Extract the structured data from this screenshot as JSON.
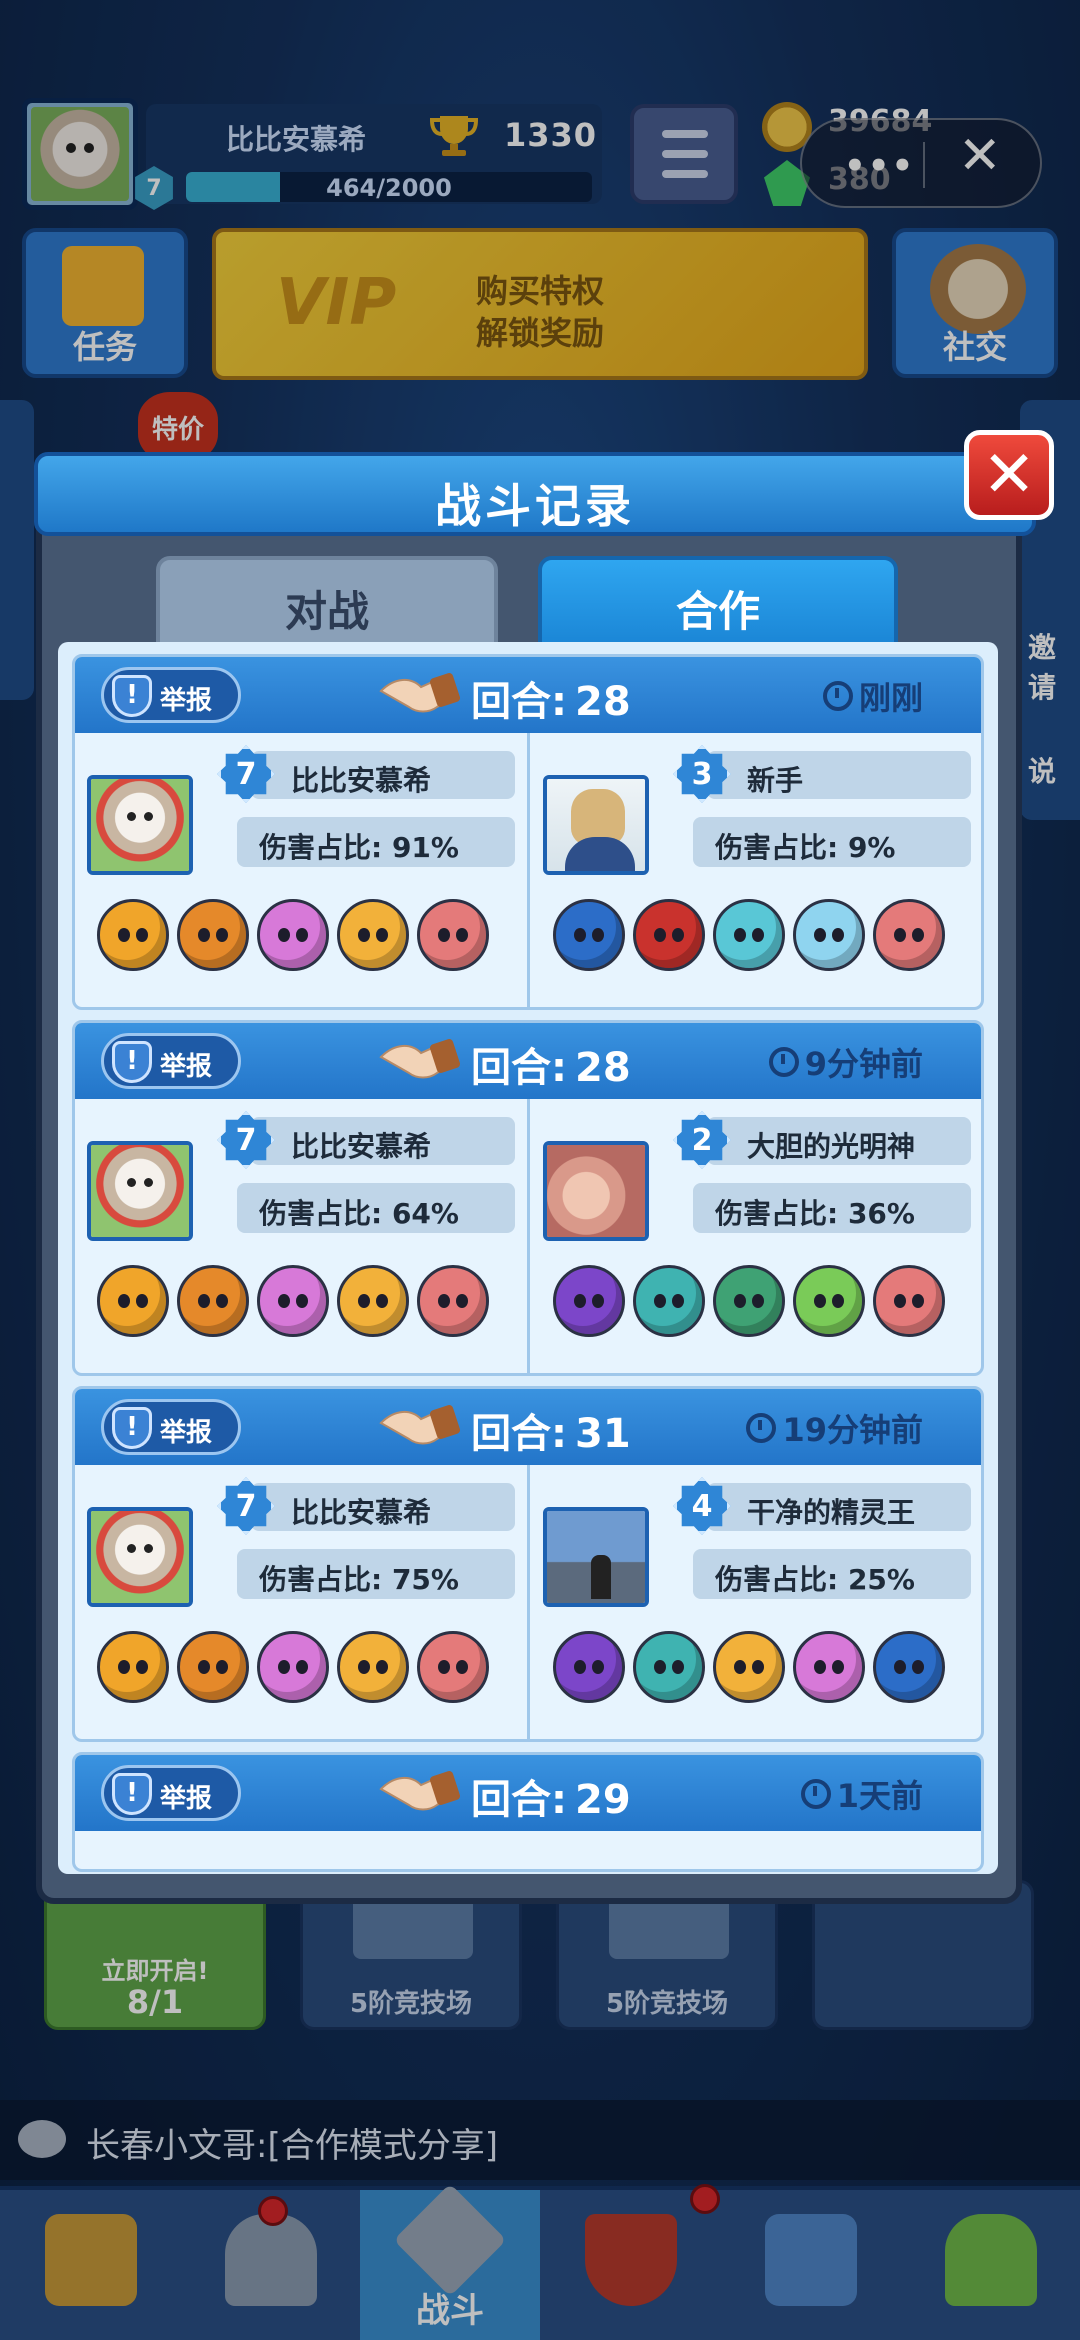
{
  "header": {
    "player_name": "比比安慕希",
    "trophies": "1330",
    "level": "7",
    "xp_text": "464/2000",
    "xp_fraction": 0.232,
    "coins": "39684",
    "gems": "380",
    "capsule_dots": "•••",
    "capsule_close": "✕"
  },
  "menu": {
    "task_label": "任务",
    "vip_logo": "VIP",
    "vip_line1": "购买特权",
    "vip_line2": "解锁奖励",
    "social_label": "社交",
    "sale_badge": "特价",
    "side_invite": "邀请",
    "side_say": "说"
  },
  "modal": {
    "title": "战斗记录",
    "close": "✕",
    "tabs": [
      {
        "label": "对战",
        "active": false
      },
      {
        "label": "合作",
        "active": true
      }
    ],
    "report_label": "举报",
    "round_prefix": "回合:",
    "damage_prefix": "伤害占比:",
    "records": [
      {
        "round": "28",
        "time": "刚刚",
        "left": {
          "level": "7",
          "name": "比比安慕希",
          "damage": "91%",
          "avatar": "cat-avatar",
          "heroes": [
            "#f0a52a",
            "#e5892a",
            "#d779d8",
            "#f2b13a",
            "#e47a7a"
          ]
        },
        "right": {
          "level": "3",
          "name": "新手",
          "damage": "9%",
          "avatar": "anime-avatar",
          "heroes": [
            "#2c6dc8",
            "#c9322d",
            "#59c7d6",
            "#8fd4ef",
            "#e47a7a"
          ]
        }
      },
      {
        "round": "28",
        "time": "9分钟前",
        "left": {
          "level": "7",
          "name": "比比安慕希",
          "damage": "64%",
          "avatar": "cat-avatar",
          "heroes": [
            "#f0a52a",
            "#e5892a",
            "#d779d8",
            "#f2b13a",
            "#e47a7a"
          ]
        },
        "right": {
          "level": "2",
          "name": "大胆的光明神",
          "damage": "36%",
          "avatar": "hands-avatar",
          "heroes": [
            "#7c46c9",
            "#3fb3b1",
            "#3fa274",
            "#7acb58",
            "#e47a7a"
          ]
        }
      },
      {
        "round": "31",
        "time": "19分钟前",
        "left": {
          "level": "7",
          "name": "比比安慕希",
          "damage": "75%",
          "avatar": "cat-avatar",
          "heroes": [
            "#f0a52a",
            "#e5892a",
            "#d779d8",
            "#f2b13a",
            "#e47a7a"
          ]
        },
        "right": {
          "level": "4",
          "name": "干净的精灵王",
          "damage": "25%",
          "avatar": "road-avatar",
          "heroes": [
            "#7c46c9",
            "#3fb3b1",
            "#f2b13a",
            "#d779d8",
            "#2c6dc8"
          ]
        }
      },
      {
        "round": "29",
        "time": "1天前"
      }
    ]
  },
  "chests": [
    {
      "line1": "立即开启!",
      "line2": "8/1",
      "state": "open"
    },
    {
      "label": "5阶竞技场"
    },
    {
      "label": "5阶竞技场"
    }
  ],
  "chat": {
    "text": "长春小文哥:[合作模式分享]"
  },
  "nav": {
    "items": [
      {
        "name": "shop",
        "icon": "treasure-chest-icon"
      },
      {
        "name": "cards",
        "icon": "knight-helmet-icon"
      },
      {
        "name": "battle",
        "icon": "crossed-swords-icon",
        "label": "战斗",
        "active": true
      },
      {
        "name": "clan",
        "icon": "crown-shield-icon"
      },
      {
        "name": "social",
        "icon": "friends-icon"
      },
      {
        "name": "events",
        "icon": "sprout-icon"
      }
    ]
  }
}
